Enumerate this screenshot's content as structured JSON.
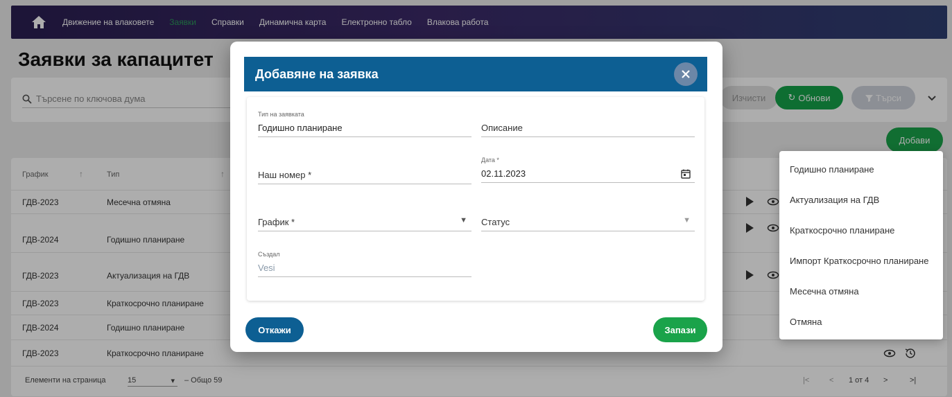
{
  "nav": {
    "items": [
      "Движение на влаковете",
      "Заявки",
      "Справки",
      "Динамична карта",
      "Електронно табло",
      "Влакова работа"
    ],
    "active_index": 1
  },
  "page": {
    "title": "Заявки за капацитет",
    "search_placeholder": "Търсене по ключова дума",
    "clear_label": "Изчисти",
    "refresh_label": "Обнови",
    "search_label": "Търси",
    "add_label": "Добави"
  },
  "table": {
    "headers": [
      "График",
      "Тип"
    ],
    "rows": [
      {
        "schedule": "ГДВ-2023",
        "type": "Месечна отмяна"
      },
      {
        "schedule": "ГДВ-2024",
        "type": "Годишно планиране"
      },
      {
        "schedule": "ГДВ-2023",
        "type": "Актуализация на ГДВ"
      },
      {
        "schedule": "ГДВ-2023",
        "type": "Краткосрочно планиране"
      },
      {
        "schedule": "ГДВ-2024",
        "type": "Годишно планиране"
      },
      {
        "schedule": "ГДВ-2023",
        "type": "Краткосрочно планиране"
      }
    ],
    "paginator": {
      "per_page_label": "Елементи на страница",
      "per_page_value": "15",
      "total_label": "– Общо 59",
      "range_label": "1 от 4"
    }
  },
  "menu": {
    "items": [
      "Годишно планиране",
      "Актуализация на ГДВ",
      "Краткосрочно планиране",
      "Импорт Краткосрочно планиране",
      "Месечна отмяна",
      "Отмяна"
    ]
  },
  "dialog": {
    "title": "Добавяне на заявка",
    "fields": {
      "type": {
        "label": "Тип на заявката",
        "value": "Годишно планиране"
      },
      "description": {
        "label": "",
        "value": "Описание"
      },
      "our_number": {
        "label": "",
        "value": "Наш номер *"
      },
      "date": {
        "label": "Дата *",
        "value": "02.11.2023"
      },
      "schedule": {
        "label": "",
        "value": "График *"
      },
      "status": {
        "label": "",
        "value": "Статус"
      },
      "created_by": {
        "label": "Създал",
        "value": "Vesi"
      }
    },
    "cancel_label": "Откажи",
    "save_label": "Запази"
  },
  "colors": {
    "accent_green": "#1aa34a",
    "dialog_blue": "#0d5f93",
    "nav_active": "#2c9a5a"
  }
}
